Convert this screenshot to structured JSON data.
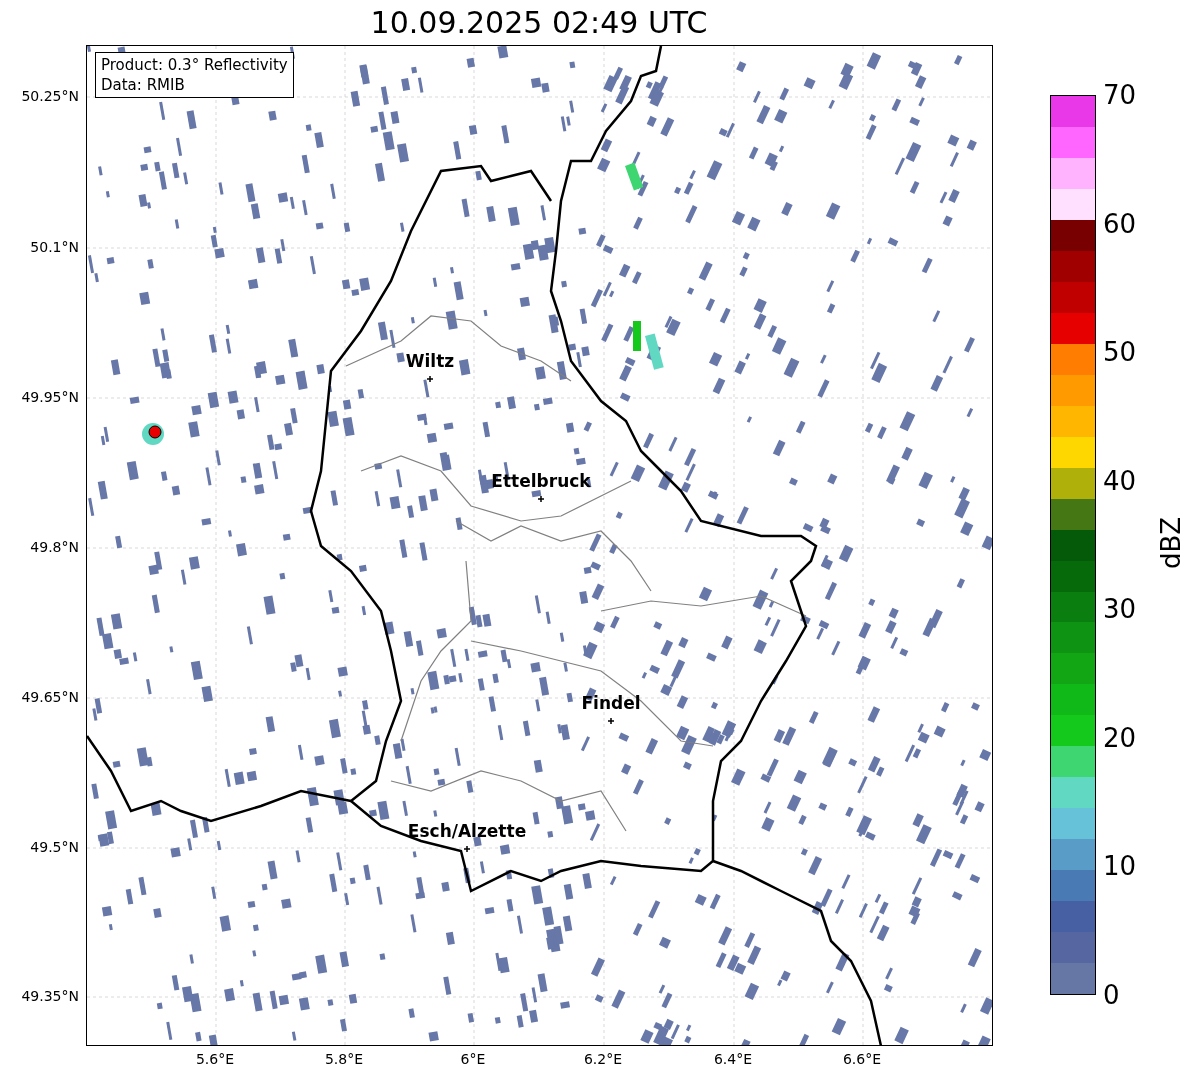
{
  "title": "10.09.2025 02:49 UTC",
  "info_box": [
    "Product: 0.3° Reflectivity",
    "Data: RMIB"
  ],
  "cities": [
    "Wiltz",
    "Ettelbruck",
    "Findel",
    "Esch/Alzette"
  ],
  "lat_ticks": [
    "50.25°N",
    "50.1°N",
    "49.95°N",
    "49.8°N",
    "49.65°N",
    "49.5°N",
    "49.35°N"
  ],
  "lon_ticks": [
    "5.6°E",
    "5.8°E",
    "6°E",
    "6.2°E",
    "6.4°E",
    "6.6°E"
  ],
  "colorbar": {
    "label": "dBZ",
    "ticks": [
      "70",
      "60",
      "50",
      "40",
      "30",
      "20",
      "10",
      "0"
    ],
    "segments": [
      {
        "color": "#e838e8"
      },
      {
        "color": "#ff66ff"
      },
      {
        "color": "#ffb3ff"
      },
      {
        "color": "#ffe0ff"
      },
      {
        "color": "#780000"
      },
      {
        "color": "#a00000"
      },
      {
        "color": "#c00000"
      },
      {
        "color": "#e60000"
      },
      {
        "color": "#ff7d00"
      },
      {
        "color": "#ff9a00"
      },
      {
        "color": "#ffb600"
      },
      {
        "color": "#ffd700"
      },
      {
        "color": "#b0b00a"
      },
      {
        "color": "#457814"
      },
      {
        "color": "#045a08"
      },
      {
        "color": "#066a0a"
      },
      {
        "color": "#0a7e0e"
      },
      {
        "color": "#0e9412"
      },
      {
        "color": "#12a614"
      },
      {
        "color": "#10b818"
      },
      {
        "color": "#14c81c"
      },
      {
        "color": "#3dd670"
      },
      {
        "color": "#60d8c2"
      },
      {
        "color": "#66c2d8"
      },
      {
        "color": "#5a9cc8"
      },
      {
        "color": "#4a7ab4"
      },
      {
        "color": "#4660a3"
      },
      {
        "color": "#5566a0"
      },
      {
        "color": "#6677a6"
      }
    ]
  }
}
